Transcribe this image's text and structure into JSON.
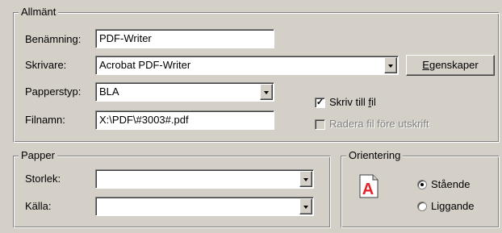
{
  "general": {
    "legend": "Allmänt",
    "name_label": "Benämning:",
    "name_value": "PDF-Writer",
    "printer_label": "Skrivare:",
    "printer_value": "Acrobat PDF-Writer",
    "properties_button": {
      "prefix": "",
      "accel": "E",
      "rest": "genskaper"
    },
    "paper_type_label": "Papperstyp:",
    "paper_type_value": "BLA",
    "filename_label": "Filnamn:",
    "filename_value": "X:\\PDF\\#3003#.pdf",
    "print_to_file": {
      "prefix": "Skriv till ",
      "accel": "f",
      "rest": "il",
      "checked": true
    },
    "delete_before_print": {
      "label": "Radera fil före utskrift",
      "checked": false,
      "enabled": false
    }
  },
  "paper": {
    "legend": "Papper",
    "size_label": "Storlek:",
    "size_value": "",
    "source_label": "Källa:",
    "source_value": ""
  },
  "orientation": {
    "legend": "Orientering",
    "portrait_label": "Stående",
    "landscape_label": "Liggande",
    "selected": "portrait",
    "icon": "portrait-page-icon",
    "icon_letter": "A",
    "icon_color": "#e8202a"
  }
}
